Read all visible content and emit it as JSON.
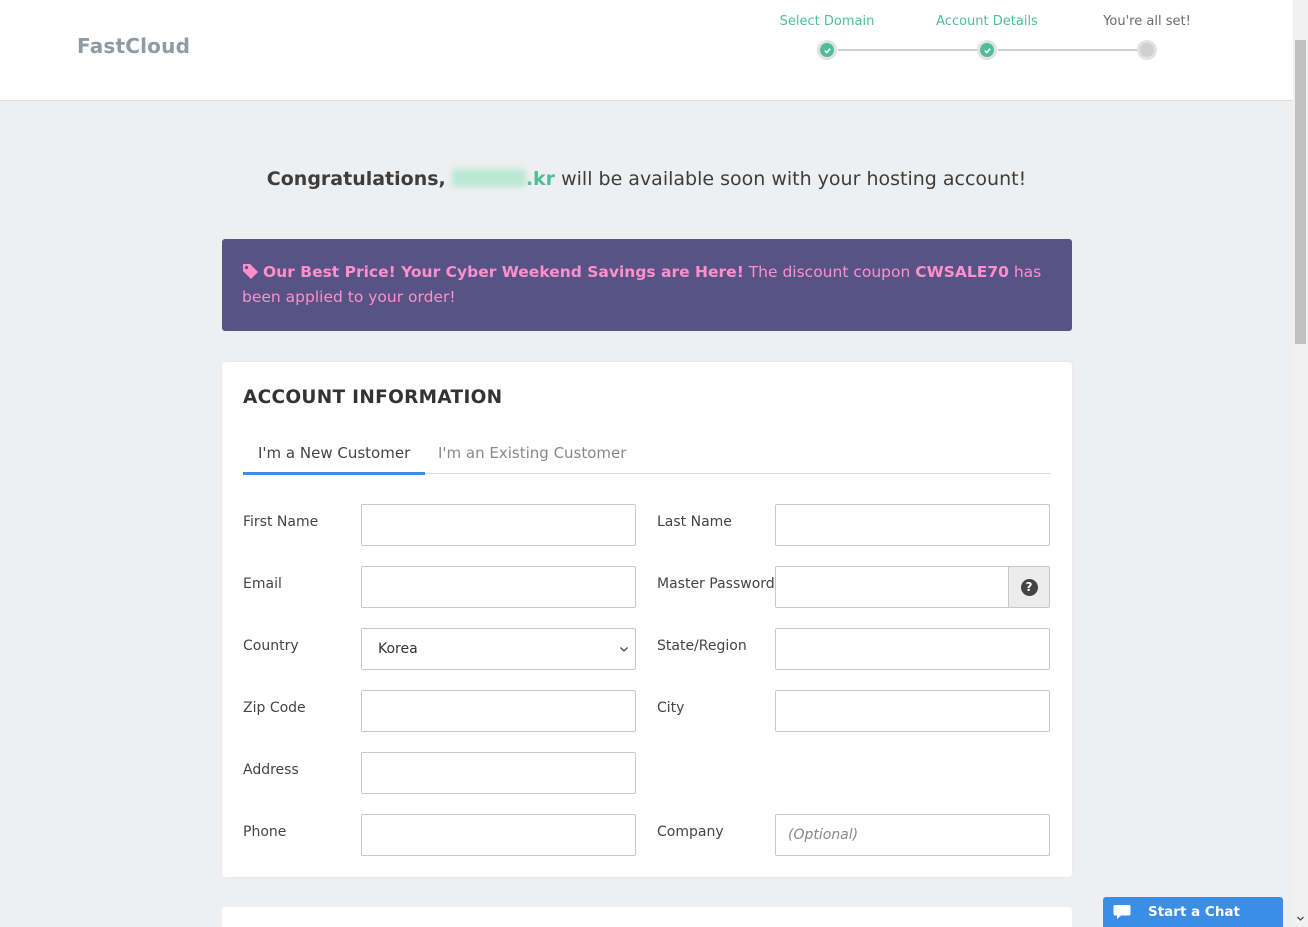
{
  "header": {
    "logo": "FastCloud"
  },
  "steps": [
    {
      "label": "Select Domain",
      "state": "done"
    },
    {
      "label": "Account Details",
      "state": "done"
    },
    {
      "label": "You're all set!",
      "state": "pending"
    }
  ],
  "congrats": {
    "prefix": "Congratulations,",
    "tld": ".kr",
    "suffix": "will be available soon with your hosting account!"
  },
  "promo": {
    "headline": "Our Best Price! Your Cyber Weekend Savings are Here!",
    "text_before": "The discount coupon",
    "coupon": "CWSALE70",
    "text_after": "has been applied to your order!"
  },
  "account": {
    "title": "ACCOUNT INFORMATION",
    "tabs": [
      "I'm a New Customer",
      "I'm an Existing Customer"
    ],
    "fields": {
      "first_name": {
        "label": "First Name",
        "value": ""
      },
      "last_name": {
        "label": "Last Name",
        "value": ""
      },
      "email": {
        "label": "Email",
        "value": ""
      },
      "master_password": {
        "label": "Master Password",
        "value": ""
      },
      "country": {
        "label": "Country",
        "value": "Korea"
      },
      "state": {
        "label": "State/Region",
        "value": ""
      },
      "zip": {
        "label": "Zip Code",
        "value": ""
      },
      "city": {
        "label": "City",
        "value": ""
      },
      "address": {
        "label": "Address",
        "value": ""
      },
      "phone": {
        "label": "Phone",
        "value": ""
      },
      "company": {
        "label": "Company",
        "placeholder": "(Optional)"
      }
    }
  },
  "chat": {
    "label": "Start a Chat"
  },
  "colors": {
    "accent_green": "#4dbf97",
    "promo_bg": "#575387",
    "promo_text": "#ff8fc8",
    "tab_active": "#3b8ee5",
    "chat_bg": "#3b8ee5"
  }
}
